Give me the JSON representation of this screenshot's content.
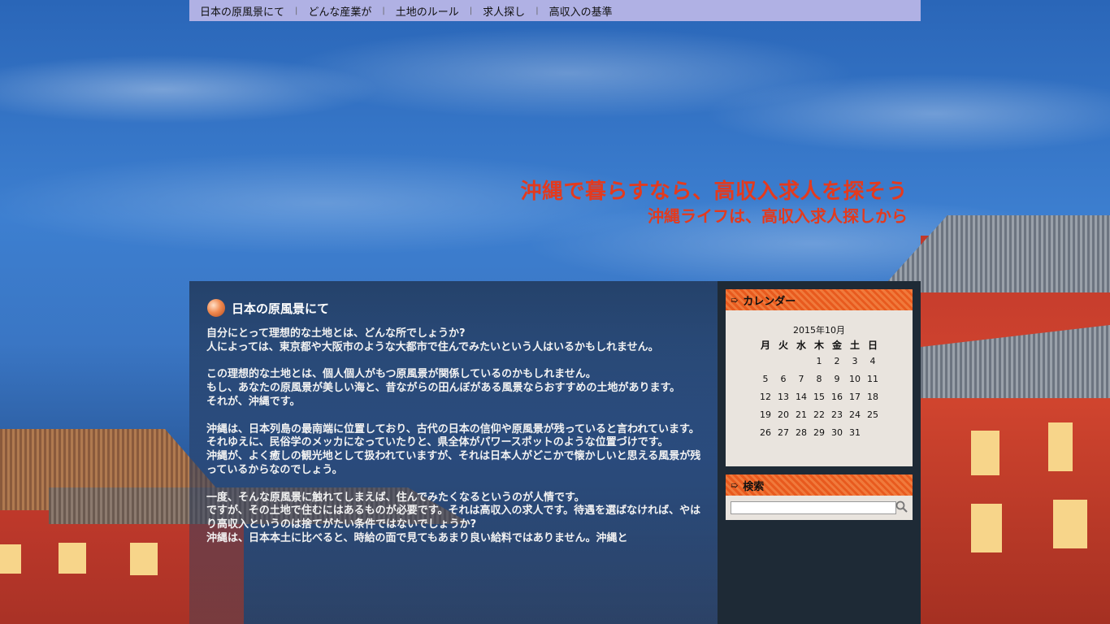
{
  "nav": {
    "items": [
      "日本の原風景にて",
      "どんな産業が",
      "土地のルール",
      "求人探し",
      "高収入の基準"
    ]
  },
  "header": {
    "title": "沖縄で暮らすなら、高収入求人を探そう",
    "subtitle": "沖縄ライフは、高収入求人探しから"
  },
  "post": {
    "title": "日本の原風景にて",
    "paragraphs": [
      [
        "自分にとって理想的な土地とは、どんな所でしょうか?",
        "人によっては、東京都や大阪市のような大都市で住んでみたいという人はいるかもしれません。"
      ],
      [
        "この理想的な土地とは、個人個人がもつ原風景が関係しているのかもしれません。",
        "もし、あなたの原風景が美しい海と、昔ながらの田んぼがある風景ならおすすめの土地があります。",
        "それが、沖縄です。"
      ],
      [
        "沖縄は、日本列島の最南端に位置しており、古代の日本の信仰や原風景が残っていると言われています。",
        "それゆえに、民俗学のメッカになっていたりと、県全体がパワースポットのような位置づけです。",
        "沖縄が、よく癒しの観光地として扱われていますが、それは日本人がどこかで懐かしいと思える風景が残っているからなのでしょう。"
      ],
      [
        "一度、そんな原風景に触れてしまえば、住んでみたくなるというのが人情です。",
        "ですが、その土地で住むにはあるものが必要です。それは高収入の求人です。待遇を選ばなければ、やはり高収入というのは捨てがたい条件ではないでしょうか?",
        "沖縄は、日本本土に比べると、時給の面で見てもあまり良い給料ではありません。沖縄と"
      ]
    ]
  },
  "sidebar": {
    "calendar": {
      "heading": "カレンダー",
      "caption": "2015年10月",
      "weekdays": [
        "月",
        "火",
        "水",
        "木",
        "金",
        "土",
        "日"
      ],
      "weeks": [
        [
          "",
          "",
          "",
          "1",
          "2",
          "3",
          "4"
        ],
        [
          "5",
          "6",
          "7",
          "8",
          "9",
          "10",
          "11"
        ],
        [
          "12",
          "13",
          "14",
          "15",
          "16",
          "17",
          "18"
        ],
        [
          "19",
          "20",
          "21",
          "22",
          "23",
          "24",
          "25"
        ],
        [
          "26",
          "27",
          "28",
          "29",
          "30",
          "31",
          ""
        ]
      ]
    },
    "search": {
      "heading": "検索",
      "value": "",
      "icon": "search-icon"
    }
  },
  "colors": {
    "title": "#e33a1e",
    "widget_head": "#e85a1e",
    "nav_bg": "#c8beeb",
    "sidebar_bg": "#1e2a36"
  }
}
